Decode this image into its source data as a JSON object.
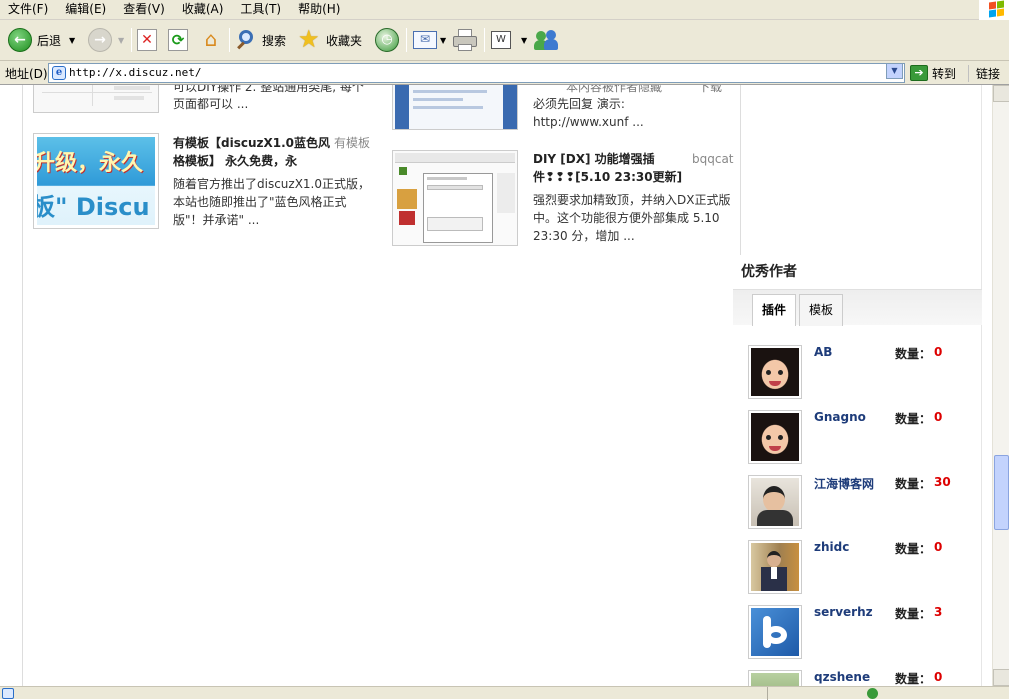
{
  "menu": [
    "文件(F)",
    "编辑(E)",
    "查看(V)",
    "收藏(A)",
    "工具(T)",
    "帮助(H)"
  ],
  "toolbar": {
    "back": "后退",
    "search": "搜索",
    "favorites": "收藏夹"
  },
  "address": {
    "label": "地址(D)",
    "url": "http://x.discuz.net/",
    "go": "转到",
    "links": "链接"
  },
  "articles": {
    "top_left_summary": "可以DIY操作 2. 整站通用类尾, 每个",
    "top_left_summary2": "页面都可以 ...",
    "top_right_summary": "本内容被作者隐藏",
    "top_right_download": "下载",
    "top_right_summary2": "必须先回复 演示:",
    "top_right_summary3": "http://www.xunf ...",
    "left": {
      "title_line1": "有模板【discuzX1.0蓝色风",
      "title_line2": "格模板】 永久免费，永",
      "author": "有模板",
      "summary_line1": "随着官方推出了discuzX1.0正式版，",
      "summary_line2": "本站也随即推出了\"蓝色风格正式",
      "summary_line3": "版\"！并承诺\" ...",
      "thumb_text1": "升级，永久",
      "thumb_text2": "板\" Discu"
    },
    "right": {
      "title_line1": "DIY [DX] 功能增强插",
      "title_line2": "件❢❢❢[5.10 23:30更新]",
      "author": "bqqcat",
      "summary_line1": "强烈要求加精致顶，并纳入DX正式版",
      "summary_line2": "中。这个功能很方便外部集成 5.10",
      "summary_line3": "23:30 分，增加 ..."
    }
  },
  "sidebar": {
    "heading": "优秀作者",
    "tabs": [
      "插件",
      "模板"
    ],
    "count_label": "数量：",
    "authors": [
      {
        "name": "AB",
        "count": "0"
      },
      {
        "name": "Gnagno",
        "count": "0"
      },
      {
        "name": "江海博客网",
        "count": "30"
      },
      {
        "name": "zhidc",
        "count": "0"
      },
      {
        "name": "serverhz",
        "count": "3"
      },
      {
        "name": "qzshene",
        "count": "0"
      }
    ]
  },
  "colors": {
    "accent": "#1e3c7a",
    "count": "#dd0000",
    "chrome": "#ece9d8"
  }
}
